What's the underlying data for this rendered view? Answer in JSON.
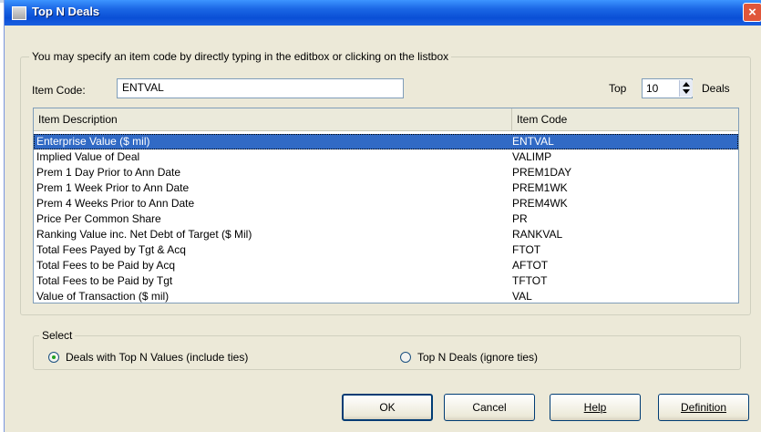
{
  "window": {
    "title": "Top N Deals",
    "close": "×"
  },
  "group_label": "You may specify an item code by directly typing in the editbox or clicking on the listbox",
  "item_code": {
    "label": "Item Code:",
    "value": "ENTVAL"
  },
  "top_n": {
    "label": "Top",
    "value": "10",
    "suffix": "Deals"
  },
  "list": {
    "columns": [
      "Item Description",
      "Item Code"
    ],
    "selected_index": 0,
    "rows": [
      {
        "desc": "Enterprise Value ($ mil)",
        "code": "ENTVAL"
      },
      {
        "desc": "Implied Value of Deal",
        "code": "VALIMP"
      },
      {
        "desc": "Prem 1 Day Prior to Ann Date",
        "code": "PREM1DAY"
      },
      {
        "desc": "Prem 1 Week Prior to Ann Date",
        "code": "PREM1WK"
      },
      {
        "desc": "Prem 4 Weeks Prior to Ann Date",
        "code": "PREM4WK"
      },
      {
        "desc": "Price Per Common Share",
        "code": "PR"
      },
      {
        "desc": "Ranking Value inc. Net Debt of Target ($ Mil)",
        "code": "RANKVAL"
      },
      {
        "desc": "Total Fees Payed by Tgt & Acq",
        "code": "FTOT"
      },
      {
        "desc": "Total Fees to be Paid by Acq",
        "code": "AFTOT"
      },
      {
        "desc": "Total Fees to be Paid by Tgt",
        "code": "TFTOT"
      },
      {
        "desc": "Value of Transaction ($ mil)",
        "code": "VAL"
      }
    ]
  },
  "select": {
    "label": "Select",
    "options": [
      "Deals with Top N Values (include ties)",
      "Top N Deals (ignore ties)"
    ],
    "selected": 0
  },
  "buttons": {
    "ok": "OK",
    "cancel": "Cancel",
    "help": "Help",
    "definition": "Definition"
  },
  "colors": {
    "selection": "#316ac5",
    "titlebar": "#0a4fd6",
    "dialog_bg": "#ece9d8"
  }
}
